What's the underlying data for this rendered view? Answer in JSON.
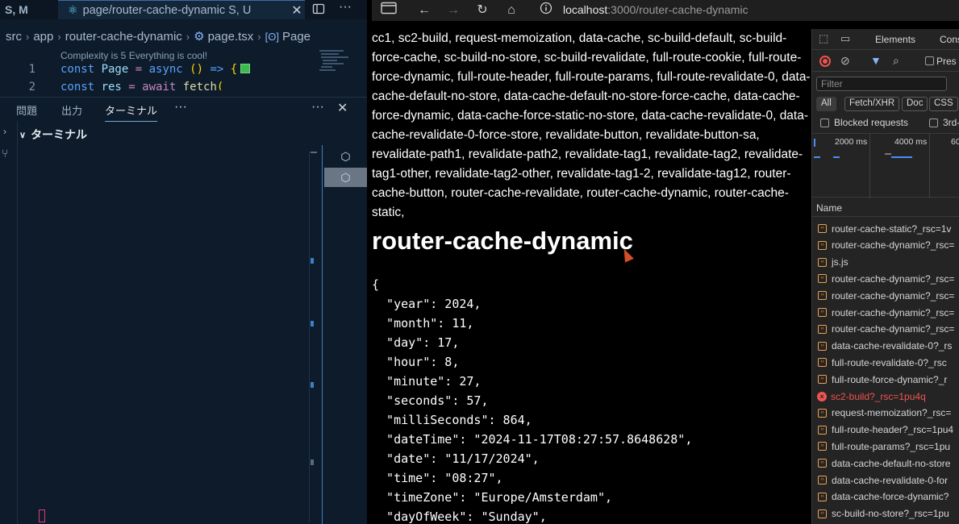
{
  "vscode": {
    "left_tab_label": "S, M",
    "active_tab": {
      "name": "page/router-cache-dynamic",
      "status": "S, U",
      "close": "✕"
    },
    "breadcrumb": [
      "src",
      "app",
      "router-cache-dynamic",
      "page.tsx",
      "Page"
    ],
    "complexity_hint": "Complexity is 5 Everything is cool!",
    "code_lines": [
      {
        "number": "1",
        "parts": [
          [
            "kw",
            "const "
          ],
          [
            "id",
            "Page "
          ],
          [
            "op",
            "= "
          ],
          [
            "kw",
            "async "
          ],
          [
            "paren",
            "() "
          ],
          [
            "kw",
            "=> "
          ],
          [
            "paren",
            "{"
          ]
        ]
      },
      {
        "number": "2",
        "parts": [
          [
            "kw",
            "    const "
          ],
          [
            "id",
            "res "
          ],
          [
            "op",
            "= "
          ],
          [
            "op",
            "await "
          ],
          [
            "fn",
            "fetch"
          ],
          [
            "paren",
            "("
          ]
        ]
      }
    ],
    "panel_tabs": [
      "問題",
      "出力",
      "ターミナル"
    ],
    "panel_more": "···",
    "panel_close": "✕",
    "terminal_header": "ターミナル"
  },
  "browser": {
    "url_host": "localhost",
    "url_path": ":3000/router-cache-dynamic",
    "links_text": "cc1, sc2-build, request-memoization, data-cache, sc-build-default, sc-build-force-cache, sc-build-no-store, sc-build-revalidate, full-route-cookie, full-route-force-dynamic, full-route-header, full-route-params, full-route-revalidate-0, data-cache-default-no-store, data-cache-default-no-store-force-cache, data-cache-force-dynamic, data-cache-force-static-no-store, data-cache-revalidate-0, data-cache-revalidate-0-force-store, revalidate-button, revalidate-button-sa, revalidate-path1, revalidate-path2, revalidate-tag1, revalidate-tag2, revalidate-tag1-other, revalidate-tag2-other, revalidate-tag1-2, revalidate-tag12, router-cache-button, router-cache-revalidate, router-cache-dynamic, router-cache-static,",
    "heading": "router-cache-dynamic",
    "json_text": "{\n  \"year\": 2024,\n  \"month\": 11,\n  \"day\": 17,\n  \"hour\": 8,\n  \"minute\": 27,\n  \"seconds\": 57,\n  \"milliSeconds\": 864,\n  \"dateTime\": \"2024-11-17T08:27:57.8648628\",\n  \"date\": \"11/17/2024\",\n  \"time\": \"08:27\",\n  \"timeZone\": \"Europe/Amsterdam\",\n  \"dayOfWeek\": \"Sunday\","
  },
  "devtools": {
    "tabs": [
      "Elements",
      "Cons"
    ],
    "preserve_label": "Pres",
    "filter_placeholder": "Filter",
    "type_chips": [
      "All",
      "Fetch/XHR",
      "Doc",
      "CSS"
    ],
    "blocked_label": "Blocked requests",
    "third_party_label": "3rd-",
    "timeline_ticks": [
      "2000 ms",
      "4000 ms",
      "60"
    ],
    "name_header": "Name",
    "requests": [
      {
        "name": "router-cache-static?_rsc=1v",
        "error": false
      },
      {
        "name": "router-cache-dynamic?_rsc=",
        "error": false
      },
      {
        "name": "js.js",
        "error": false
      },
      {
        "name": "router-cache-dynamic?_rsc=",
        "error": false
      },
      {
        "name": "router-cache-dynamic?_rsc=",
        "error": false
      },
      {
        "name": "router-cache-dynamic?_rsc=",
        "error": false
      },
      {
        "name": "router-cache-dynamic?_rsc=",
        "error": false
      },
      {
        "name": "data-cache-revalidate-0?_rs",
        "error": false
      },
      {
        "name": "full-route-revalidate-0?_rsc",
        "error": false
      },
      {
        "name": "full-route-force-dynamic?_r",
        "error": false
      },
      {
        "name": "sc2-build?_rsc=1pu4q",
        "error": true
      },
      {
        "name": "request-memoization?_rsc=",
        "error": false
      },
      {
        "name": "full-route-header?_rsc=1pu4",
        "error": false
      },
      {
        "name": "full-route-params?_rsc=1pu",
        "error": false
      },
      {
        "name": "data-cache-default-no-store",
        "error": false
      },
      {
        "name": "data-cache-revalidate-0-for",
        "error": false
      },
      {
        "name": "data-cache-force-dynamic?",
        "error": false
      },
      {
        "name": "sc-build-no-store?_rsc=1pu",
        "error": false
      }
    ]
  }
}
